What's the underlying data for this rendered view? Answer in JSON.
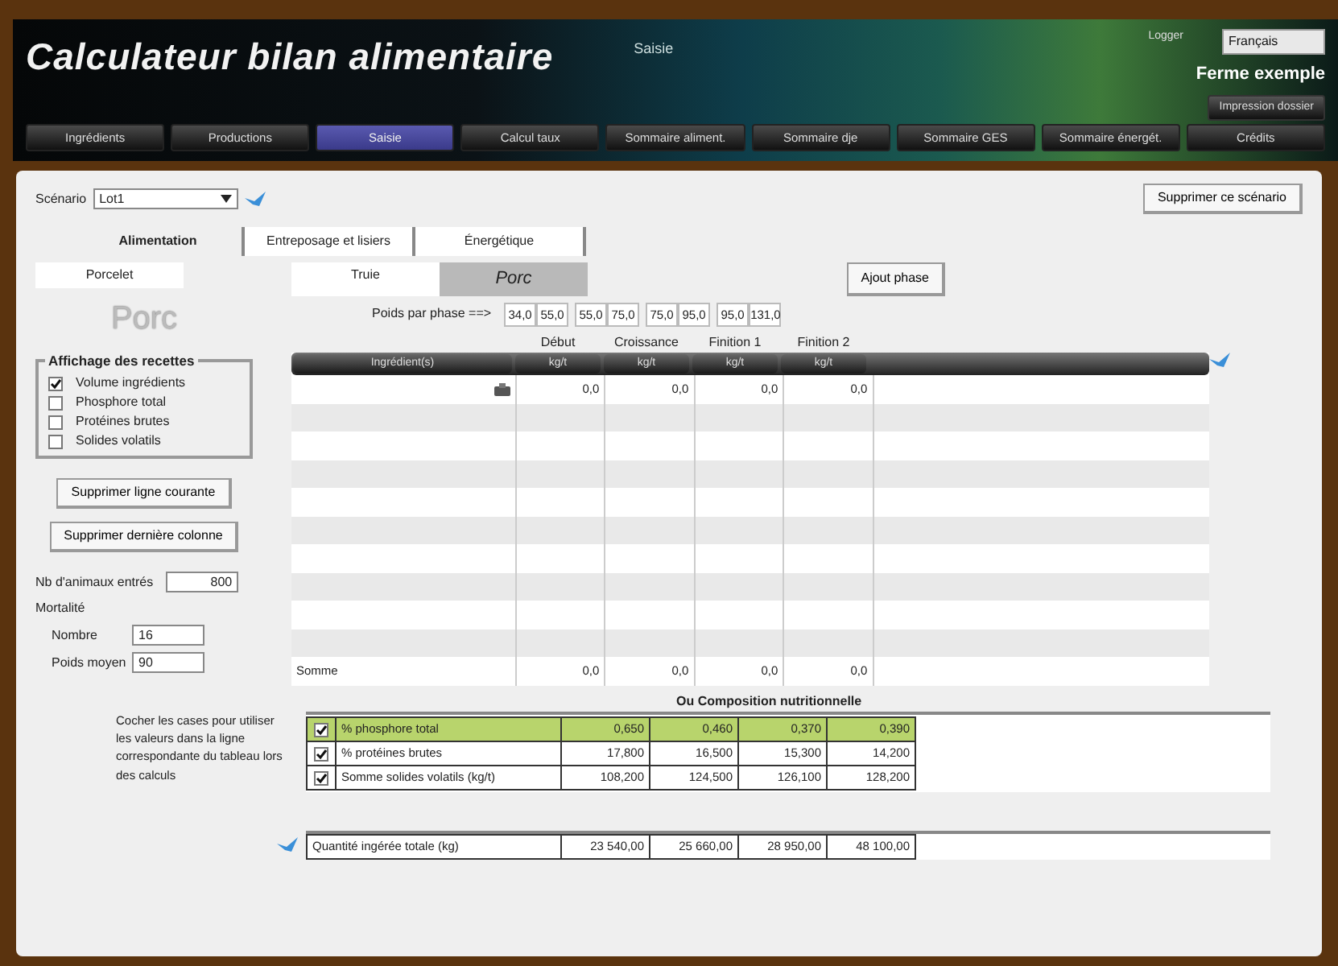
{
  "header": {
    "title": "Calculateur bilan alimentaire",
    "section": "Saisie",
    "login": "Logger",
    "language": "Français",
    "farm": "Ferme exemple",
    "print_button": "Impression dossier"
  },
  "nav": [
    {
      "label": "Ingrédients",
      "selected": false
    },
    {
      "label": "Productions",
      "selected": false
    },
    {
      "label": "Saisie",
      "selected": true
    },
    {
      "label": "Calcul taux",
      "selected": false
    },
    {
      "label": "Sommaire aliment.",
      "selected": false
    },
    {
      "label": "Sommaire dje",
      "selected": false
    },
    {
      "label": "Sommaire GES",
      "selected": false
    },
    {
      "label": "Sommaire énergét.",
      "selected": false
    },
    {
      "label": "Crédits",
      "selected": false
    }
  ],
  "scenario": {
    "label": "Scénario",
    "value": "Lot1",
    "delete_button": "Supprimer ce scénario"
  },
  "tabs": [
    {
      "label": "Alimentation",
      "selected": true
    },
    {
      "label": "Entreposage et lisiers",
      "selected": false
    },
    {
      "label": "Énergétique",
      "selected": false
    }
  ],
  "animal_tabs": [
    {
      "label": "Porcelet",
      "selected": false
    },
    {
      "label": "Truie",
      "selected": false
    },
    {
      "label": "Porc",
      "selected": true
    }
  ],
  "heading": "Porc",
  "display_group": {
    "title": "Affichage des recettes",
    "options": [
      {
        "label": "Volume ingrédients",
        "checked": true
      },
      {
        "label": "Phosphore total",
        "checked": false
      },
      {
        "label": "Protéines brutes",
        "checked": false
      },
      {
        "label": "Solides volatils",
        "checked": false
      }
    ]
  },
  "left_buttons": [
    "Supprimer ligne courante",
    "Supprimer dernière colonne"
  ],
  "animals": {
    "label": "Nb d'animaux entrés",
    "value": "800"
  },
  "mortality": {
    "label": "Mortalité",
    "fields": [
      {
        "label": "Nombre",
        "value": "16"
      },
      {
        "label": "Poids moyen",
        "value": "90"
      }
    ]
  },
  "add_phase_button": "Ajout phase",
  "weights": {
    "label": "Poids par phase ==>",
    "pairs": [
      [
        "34,0",
        "55,0"
      ],
      [
        "55,0",
        "75,0"
      ],
      [
        "75,0",
        "95,0"
      ],
      [
        "95,0",
        "131,0"
      ]
    ]
  },
  "recipe_table": {
    "phases": [
      "Début",
      "Croissance",
      "Finition 1",
      "Finition 2"
    ],
    "columns": [
      "Ingrédient(s)",
      "kg/t",
      "kg/t",
      "kg/t",
      "kg/t"
    ],
    "rows": [
      [
        "",
        "0,0",
        "0,0",
        "0,0",
        "0,0"
      ]
    ],
    "total": [
      "Somme",
      "0,0",
      "0,0",
      "0,0",
      "0,0"
    ]
  },
  "composition": {
    "title": "Ou  Composition nutritionnelle",
    "note": "Cocher les cases pour utiliser les valeurs dans la ligne correspondante du tableau lors des calculs",
    "rows": [
      {
        "checked": true,
        "highlighted": true,
        "cells": [
          "% phosphore total",
          "0,650",
          "0,460",
          "0,370",
          "0,390"
        ]
      },
      {
        "checked": true,
        "highlighted": false,
        "cells": [
          "% protéines brutes",
          "17,800",
          "16,500",
          "15,300",
          "14,200"
        ]
      },
      {
        "checked": true,
        "highlighted": false,
        "cells": [
          "Somme solides volatils (kg/t)",
          "108,200",
          "124,500",
          "126,100",
          "128,200"
        ]
      }
    ]
  },
  "intake": [
    "Quantité ingérée totale  (kg)",
    "23 540,00",
    "25 660,00",
    "28 950,00",
    "48 100,00"
  ]
}
